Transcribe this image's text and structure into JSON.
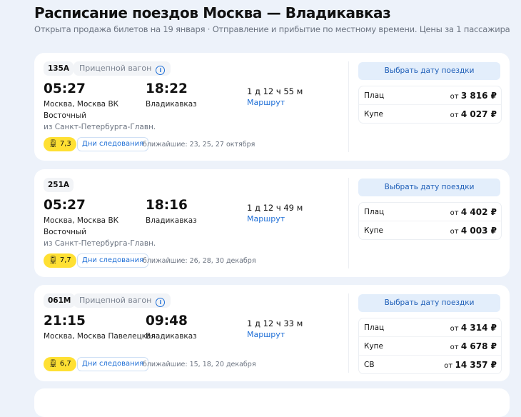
{
  "header": {
    "title": "Расписание поездов Москва — Владикавказ",
    "subtitle": "Открыта продажа билетов на 19 января · Отправление и прибытие по местному времени. Цены за 1 пассажира"
  },
  "trains": [
    {
      "number": "135А",
      "trailer": "Прицепной вагон",
      "dep_time": "05:27",
      "dep_station": "Москва, Москва ВК",
      "dep_station2": "Восточный",
      "origin": "из Санкт-Петербурга-Главн.",
      "arr_time": "18:22",
      "arr_station": "Владикавказ",
      "duration": "1 д 12 ч 55 м",
      "route": "Маршрут",
      "rating": "7,3",
      "days": "Дни следования",
      "nearest": "ближайшие: 23, 25, 27 октября",
      "pick": "Выбрать дату поездки",
      "prices": [
        {
          "class": "Плац",
          "prefix": "от",
          "price": "3 816 ₽"
        },
        {
          "class": "Купе",
          "prefix": "от",
          "price": "4 027 ₽"
        }
      ]
    },
    {
      "number": "251А",
      "dep_time": "05:27",
      "dep_station": "Москва, Москва ВК",
      "dep_station2": "Восточный",
      "origin": "из Санкт-Петербурга-Главн.",
      "arr_time": "18:16",
      "arr_station": "Владикавказ",
      "duration": "1 д 12 ч 49 м",
      "route": "Маршрут",
      "rating": "7,7",
      "days": "Дни следования",
      "nearest": "ближайшие: 26, 28, 30 декабря",
      "pick": "Выбрать дату поездки",
      "prices": [
        {
          "class": "Плац",
          "prefix": "от",
          "price": "4 402 ₽"
        },
        {
          "class": "Купе",
          "prefix": "от",
          "price": "4 003 ₽"
        }
      ]
    },
    {
      "number": "061М",
      "trailer": "Прицепной вагон",
      "dep_time": "21:15",
      "dep_station": "Москва, Москва Павелецкая",
      "arr_time": "09:48",
      "arr_station": "Владикавказ",
      "duration": "1 д 12 ч 33 м",
      "route": "Маршрут",
      "rating": "6,7",
      "days": "Дни следования",
      "nearest": "ближайшие: 15, 18, 20 декабря",
      "pick": "Выбрать дату поездки",
      "prices": [
        {
          "class": "Плац",
          "prefix": "от",
          "price": "4 314 ₽"
        },
        {
          "class": "Купе",
          "prefix": "от",
          "price": "4 678 ₽"
        },
        {
          "class": "СВ",
          "prefix": "от",
          "price": "14 357 ₽"
        }
      ]
    }
  ]
}
